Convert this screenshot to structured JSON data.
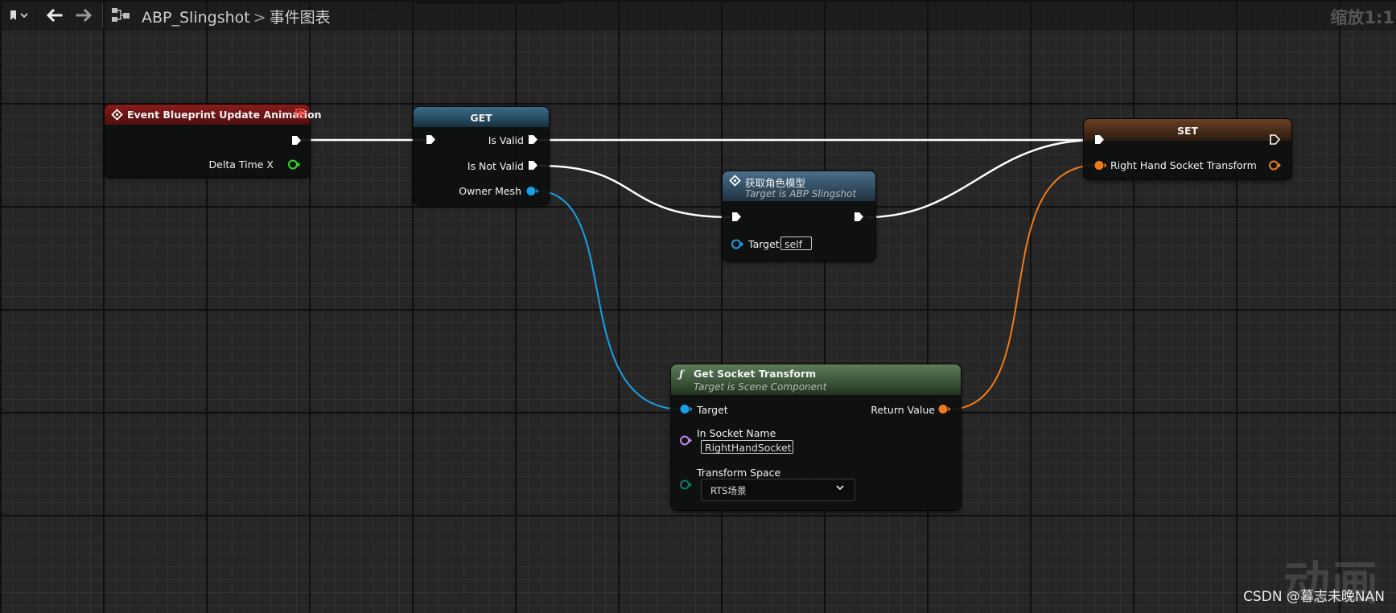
{
  "toolbar": {
    "bookmark_icon": "bookmark-icon",
    "back_icon": "arrow-left-icon",
    "forward_icon": "arrow-right-icon",
    "graph_icon": "graph-icon",
    "breadcrumb": {
      "asset": "ABP_Slingshot",
      "separator": ">",
      "graph": "事件图表"
    },
    "zoom": "缩放1:1"
  },
  "nodes": {
    "event": {
      "title": "Event Blueprint Update Animation",
      "pins": {
        "delta_time": "Delta Time X"
      }
    },
    "get": {
      "title": "GET",
      "pins": {
        "is_valid": "Is Valid",
        "is_not_valid": "Is Not Valid",
        "owner_mesh": "Owner Mesh"
      }
    },
    "get_mesh": {
      "title": "获取角色模型",
      "subtitle": "Target is ABP Slingshot",
      "pins": {
        "target": "Target",
        "target_value": "self"
      }
    },
    "socket": {
      "title": "Get Socket Transform",
      "subtitle": "Target is Scene Component",
      "pins": {
        "target": "Target",
        "return_value": "Return Value",
        "in_socket_name": "In Socket Name",
        "in_socket_value": "RightHandSocket",
        "transform_space": "Transform Space",
        "transform_space_value": "RTS场景"
      }
    },
    "set": {
      "title": "SET",
      "pins": {
        "right_hand": "Right Hand Socket Transform"
      }
    }
  },
  "colors": {
    "exec": "#ffffff",
    "float_pin": "#35d62c",
    "object_pin": "#1aa0e8",
    "transform_pin": "#f07a1a",
    "name_pin": "#c285f2",
    "enum_pin": "#0d7866"
  },
  "overlay": {
    "watermark": "动画",
    "credit": "CSDN @暮志未晚NAN"
  }
}
